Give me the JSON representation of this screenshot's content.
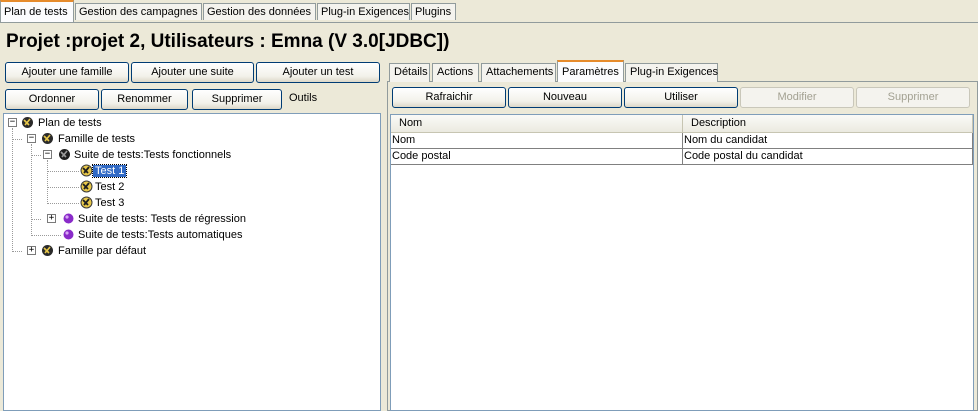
{
  "top_tabs": [
    "Plan de tests",
    "Gestion des campagnes",
    "Gestion des données",
    "Plug-in Exigences",
    "Plugins"
  ],
  "project_title": "Projet :projet 2, Utilisateurs : Emna (V 3.0[JDBC])",
  "left_toolbar": {
    "add_family": "Ajouter une famille",
    "add_suite": "Ajouter une suite",
    "add_test": "Ajouter un test",
    "order": "Ordonner",
    "rename": "Renommer",
    "delete": "Supprimer",
    "tools": "Outils"
  },
  "tree": {
    "root": "Plan de tests",
    "family": "Famille de tests",
    "suite_functional": "Suite de tests:Tests fonctionnels",
    "test1": "Test 1",
    "test2": "Test 2",
    "test3": "Test 3",
    "suite_regression": "Suite de tests: Tests de régression",
    "suite_auto": "Suite de tests:Tests automatiques",
    "default_family": "Famille par défaut",
    "selected": "Test 1"
  },
  "right_tabs": [
    "Détails",
    "Actions",
    "Attachements",
    "Paramètres",
    "Plug-in Exigences"
  ],
  "right_toolbar": {
    "refresh": "Rafraichir",
    "new": "Nouveau",
    "use": "Utiliser",
    "modify": "Modifier",
    "delete": "Supprimer"
  },
  "params_table": {
    "headers": [
      "Nom",
      "Description"
    ],
    "rows": [
      [
        "Nom",
        "Nom du candidat"
      ],
      [
        "Code postal",
        "Code postal du candidat"
      ]
    ]
  },
  "colors": {
    "active_tab_accent": "#e68b2c",
    "selection": "#316ac5",
    "window_bg": "#ece9d8"
  }
}
